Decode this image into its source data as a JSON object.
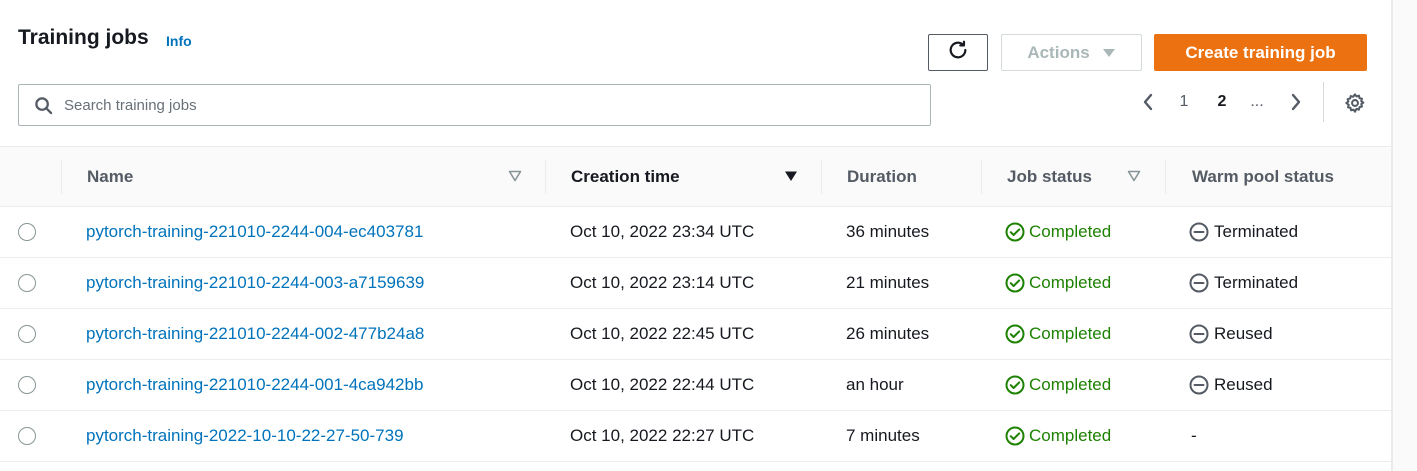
{
  "header": {
    "title": "Training jobs",
    "info_label": "Info"
  },
  "toolbar": {
    "refresh_icon": "refresh-icon",
    "actions_label": "Actions",
    "create_label": "Create training job",
    "accent_color": "#ec7211"
  },
  "search": {
    "placeholder": "Search training jobs",
    "value": ""
  },
  "pagination": {
    "pages": [
      "1",
      "2"
    ],
    "current": "2",
    "ellipsis": "..."
  },
  "table": {
    "columns": {
      "name": "Name",
      "creation_time": "Creation time",
      "duration": "Duration",
      "job_status": "Job status",
      "warm_pool_status": "Warm pool status"
    },
    "rows": [
      {
        "name": "pytorch-training-221010-2244-004-ec403781",
        "creation_time": "Oct 10, 2022 23:34 UTC",
        "duration": "36 minutes",
        "job_status": "Completed",
        "warm_pool_status": "Terminated"
      },
      {
        "name": "pytorch-training-221010-2244-003-a7159639",
        "creation_time": "Oct 10, 2022 23:14 UTC",
        "duration": "21 minutes",
        "job_status": "Completed",
        "warm_pool_status": "Terminated"
      },
      {
        "name": "pytorch-training-221010-2244-002-477b24a8",
        "creation_time": "Oct 10, 2022 22:45 UTC",
        "duration": "26 minutes",
        "job_status": "Completed",
        "warm_pool_status": "Reused"
      },
      {
        "name": "pytorch-training-221010-2244-001-4ca942bb",
        "creation_time": "Oct 10, 2022 22:44 UTC",
        "duration": "an hour",
        "job_status": "Completed",
        "warm_pool_status": "Reused"
      },
      {
        "name": "pytorch-training-2022-10-10-22-27-50-739",
        "creation_time": "Oct 10, 2022 22:27 UTC",
        "duration": "7 minutes",
        "job_status": "Completed",
        "warm_pool_status": "-"
      }
    ],
    "status_color": "#1d8102",
    "link_color": "#0073bb"
  }
}
